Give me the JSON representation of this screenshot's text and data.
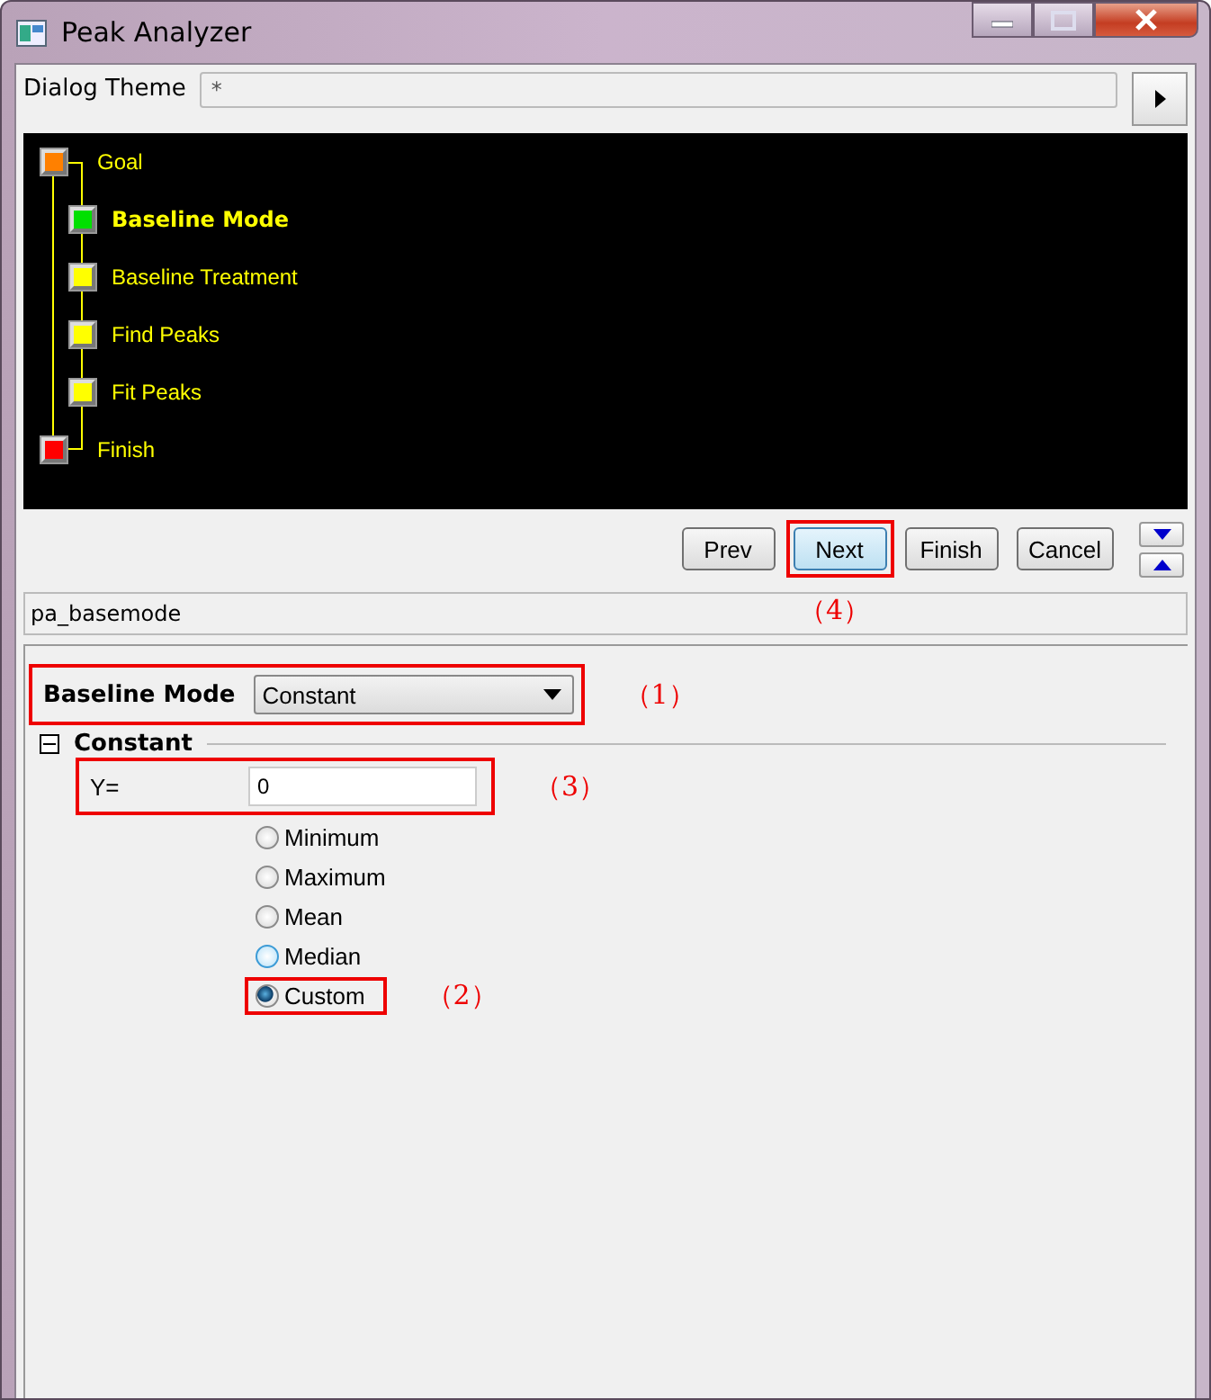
{
  "window": {
    "title": "Peak Analyzer"
  },
  "theme": {
    "label": "Dialog Theme",
    "value": "*"
  },
  "steps": [
    {
      "label": "Goal",
      "color": "#ff8000",
      "selected": false,
      "children": [
        {
          "label": "Baseline Mode",
          "color": "#00e000",
          "selected": true
        },
        {
          "label": "Baseline Treatment",
          "color": "#ffff00",
          "selected": false
        },
        {
          "label": "Find Peaks",
          "color": "#ffff00",
          "selected": false
        },
        {
          "label": "Fit Peaks",
          "color": "#ffff00",
          "selected": false
        }
      ]
    },
    {
      "label": "Finish",
      "color": "#ff0000",
      "selected": false
    }
  ],
  "buttons": [
    {
      "label": "Prev",
      "focused": false
    },
    {
      "label": "Next",
      "focused": true,
      "annotation": "（4）"
    },
    {
      "label": "Finish",
      "focused": false
    },
    {
      "label": "Cancel",
      "focused": false
    }
  ],
  "page_name": "pa_basemode",
  "baseline_mode": {
    "label": "Baseline Mode",
    "value": "Constant",
    "annotation": "（1）"
  },
  "group": {
    "title": "Constant",
    "expanded": true
  },
  "y_field": {
    "label": "Y=",
    "value": "0",
    "annotation": "（3）"
  },
  "options": [
    {
      "label": "Minimum",
      "selected": false,
      "hovered": false
    },
    {
      "label": "Maximum",
      "selected": false,
      "hovered": false
    },
    {
      "label": "Mean",
      "selected": false,
      "hovered": false
    },
    {
      "label": "Median",
      "selected": false,
      "hovered": true
    },
    {
      "label": "Custom",
      "selected": true,
      "hovered": false,
      "annotation": "（2）"
    }
  ]
}
